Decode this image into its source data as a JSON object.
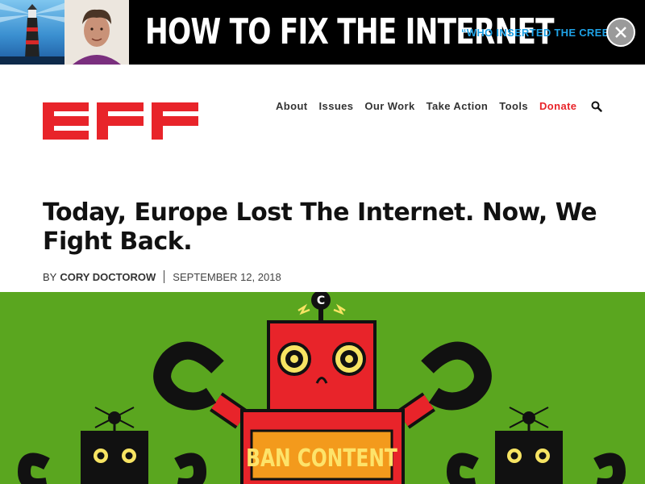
{
  "banner": {
    "title": "HOW TO FIX THE INTERNET",
    "quote": "“WHO INSERTED THE CREEPY?”"
  },
  "nav": {
    "items": [
      "About",
      "Issues",
      "Our Work",
      "Take Action",
      "Tools"
    ],
    "donate": "Donate"
  },
  "article": {
    "title": "Today, Europe Lost The Internet. Now, We Fight Back.",
    "by": "BY",
    "author": "CORY DOCTOROW",
    "date": "SEPTEMBER 12, 2018"
  },
  "hero": {
    "sign_text": "BAN CONTENT"
  },
  "colors": {
    "banner_bg": "#000000",
    "banner_accent": "#1fa2e6",
    "brand_red": "#e8242a",
    "hero_green": "#5aa61f",
    "robot_red": "#e8242a",
    "sign_orange": "#f39a1c",
    "sign_text": "#fde36a"
  }
}
